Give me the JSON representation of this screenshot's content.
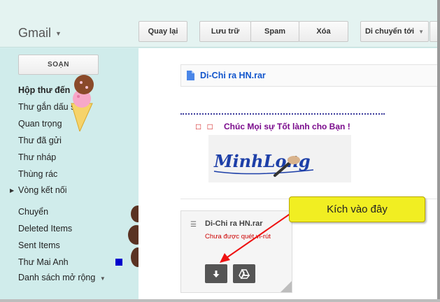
{
  "app": {
    "brand": "Gmail"
  },
  "toolbar": {
    "back": "Quay lại",
    "archive": "Lưu trữ",
    "spam": "Spam",
    "delete": "Xóa",
    "move_to": "Di chuyển tới"
  },
  "sidebar": {
    "compose": "SOẠN",
    "items": [
      {
        "label": "Hộp thư đến"
      },
      {
        "label": "Thư gắn dấu sao"
      },
      {
        "label": "Quan trọng"
      },
      {
        "label": "Thư đã gửi"
      },
      {
        "label": "Thư nháp"
      },
      {
        "label": "Thùng rác"
      },
      {
        "label": "Vòng kết nối"
      },
      {
        "label": "Chuyển"
      },
      {
        "label": "Deleted Items"
      },
      {
        "label": "Sent Items"
      },
      {
        "label": "Thư Mai Anh"
      },
      {
        "label": "Danh sách mở rộng"
      }
    ],
    "label_color": "#0000cc"
  },
  "message": {
    "attachment_title": "Di-Chi ra HN.rar",
    "boxes": "□ □",
    "greeting": "Chúc Mọi sự Tốt lành cho Bạn !",
    "signature": "MinhLong"
  },
  "attachment_card": {
    "name": "Di-Chi ra HN.rar",
    "status": "Chưa được quét vi-rút",
    "download_icon": "download-icon",
    "drive_icon": "drive-icon"
  },
  "callout": {
    "text": "Kích vào đây"
  },
  "colors": {
    "accent": "#1155cc",
    "callout": "#f1ee22",
    "arrow": "#ee1111",
    "greeting": "#7a0a8c"
  }
}
